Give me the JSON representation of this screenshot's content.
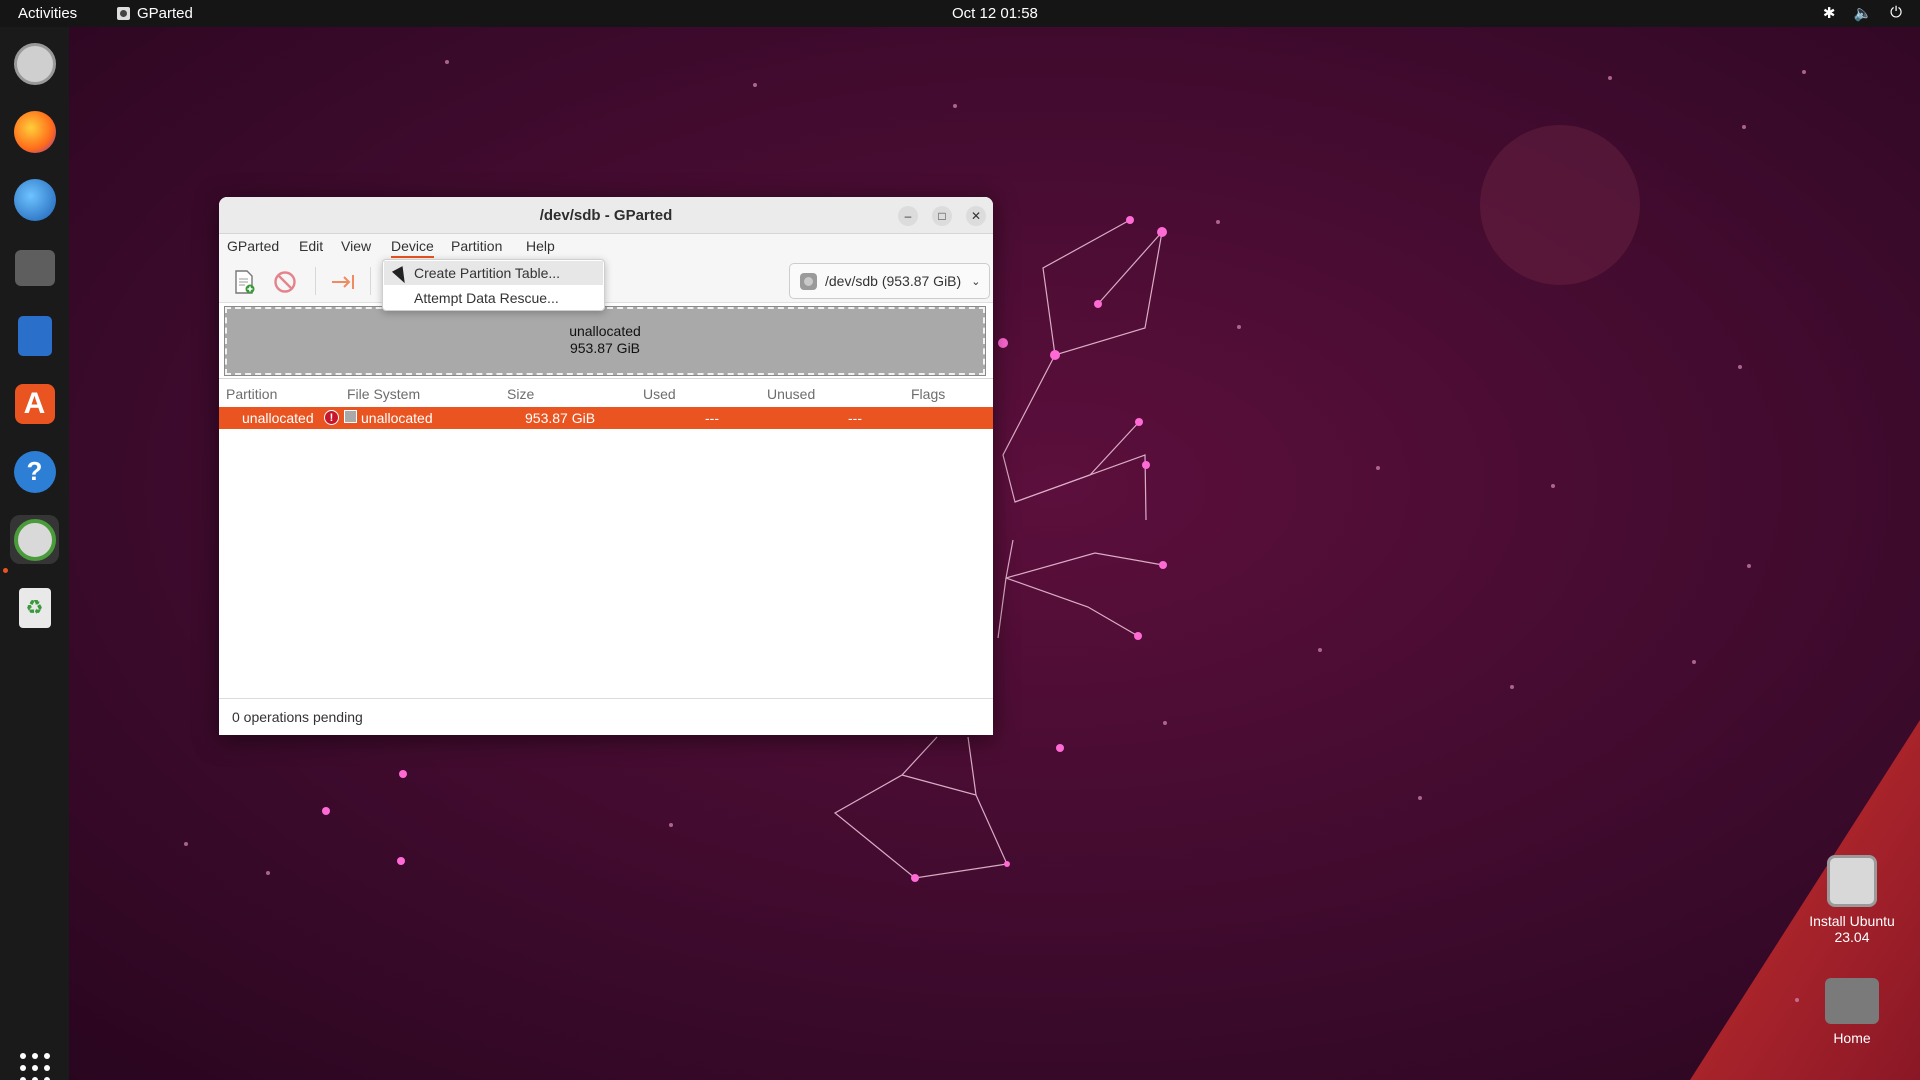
{
  "topbar": {
    "activities": "Activities",
    "app_name": "GParted",
    "clock": "Oct 12  01:58"
  },
  "desktop": {
    "install_label_line1": "Install Ubuntu",
    "install_label_line2": "23.04",
    "home_label": "Home"
  },
  "window": {
    "title": "/dev/sdb - GParted",
    "menu": {
      "gparted": "GParted",
      "edit": "Edit",
      "view": "View",
      "device": "Device",
      "partition": "Partition",
      "help": "Help"
    },
    "device_selector": "/dev/sdb (953.87 GiB)",
    "graph": {
      "label": "unallocated",
      "size": "953.87 GiB"
    },
    "table": {
      "headers": {
        "partition": "Partition",
        "filesystem": "File System",
        "size": "Size",
        "used": "Used",
        "unused": "Unused",
        "flags": "Flags"
      },
      "rows": [
        {
          "partition": "unallocated",
          "warning": "!",
          "filesystem": "unallocated",
          "size": "953.87 GiB",
          "used": "---",
          "unused": "---",
          "flags": ""
        }
      ]
    },
    "status": "0 operations pending"
  },
  "device_menu": {
    "items": [
      {
        "label": "Create Partition Table..."
      },
      {
        "label": "Attempt Data Rescue..."
      }
    ]
  },
  "colors": {
    "accent": "#e95420",
    "unallocated": "#a9a9a9"
  }
}
